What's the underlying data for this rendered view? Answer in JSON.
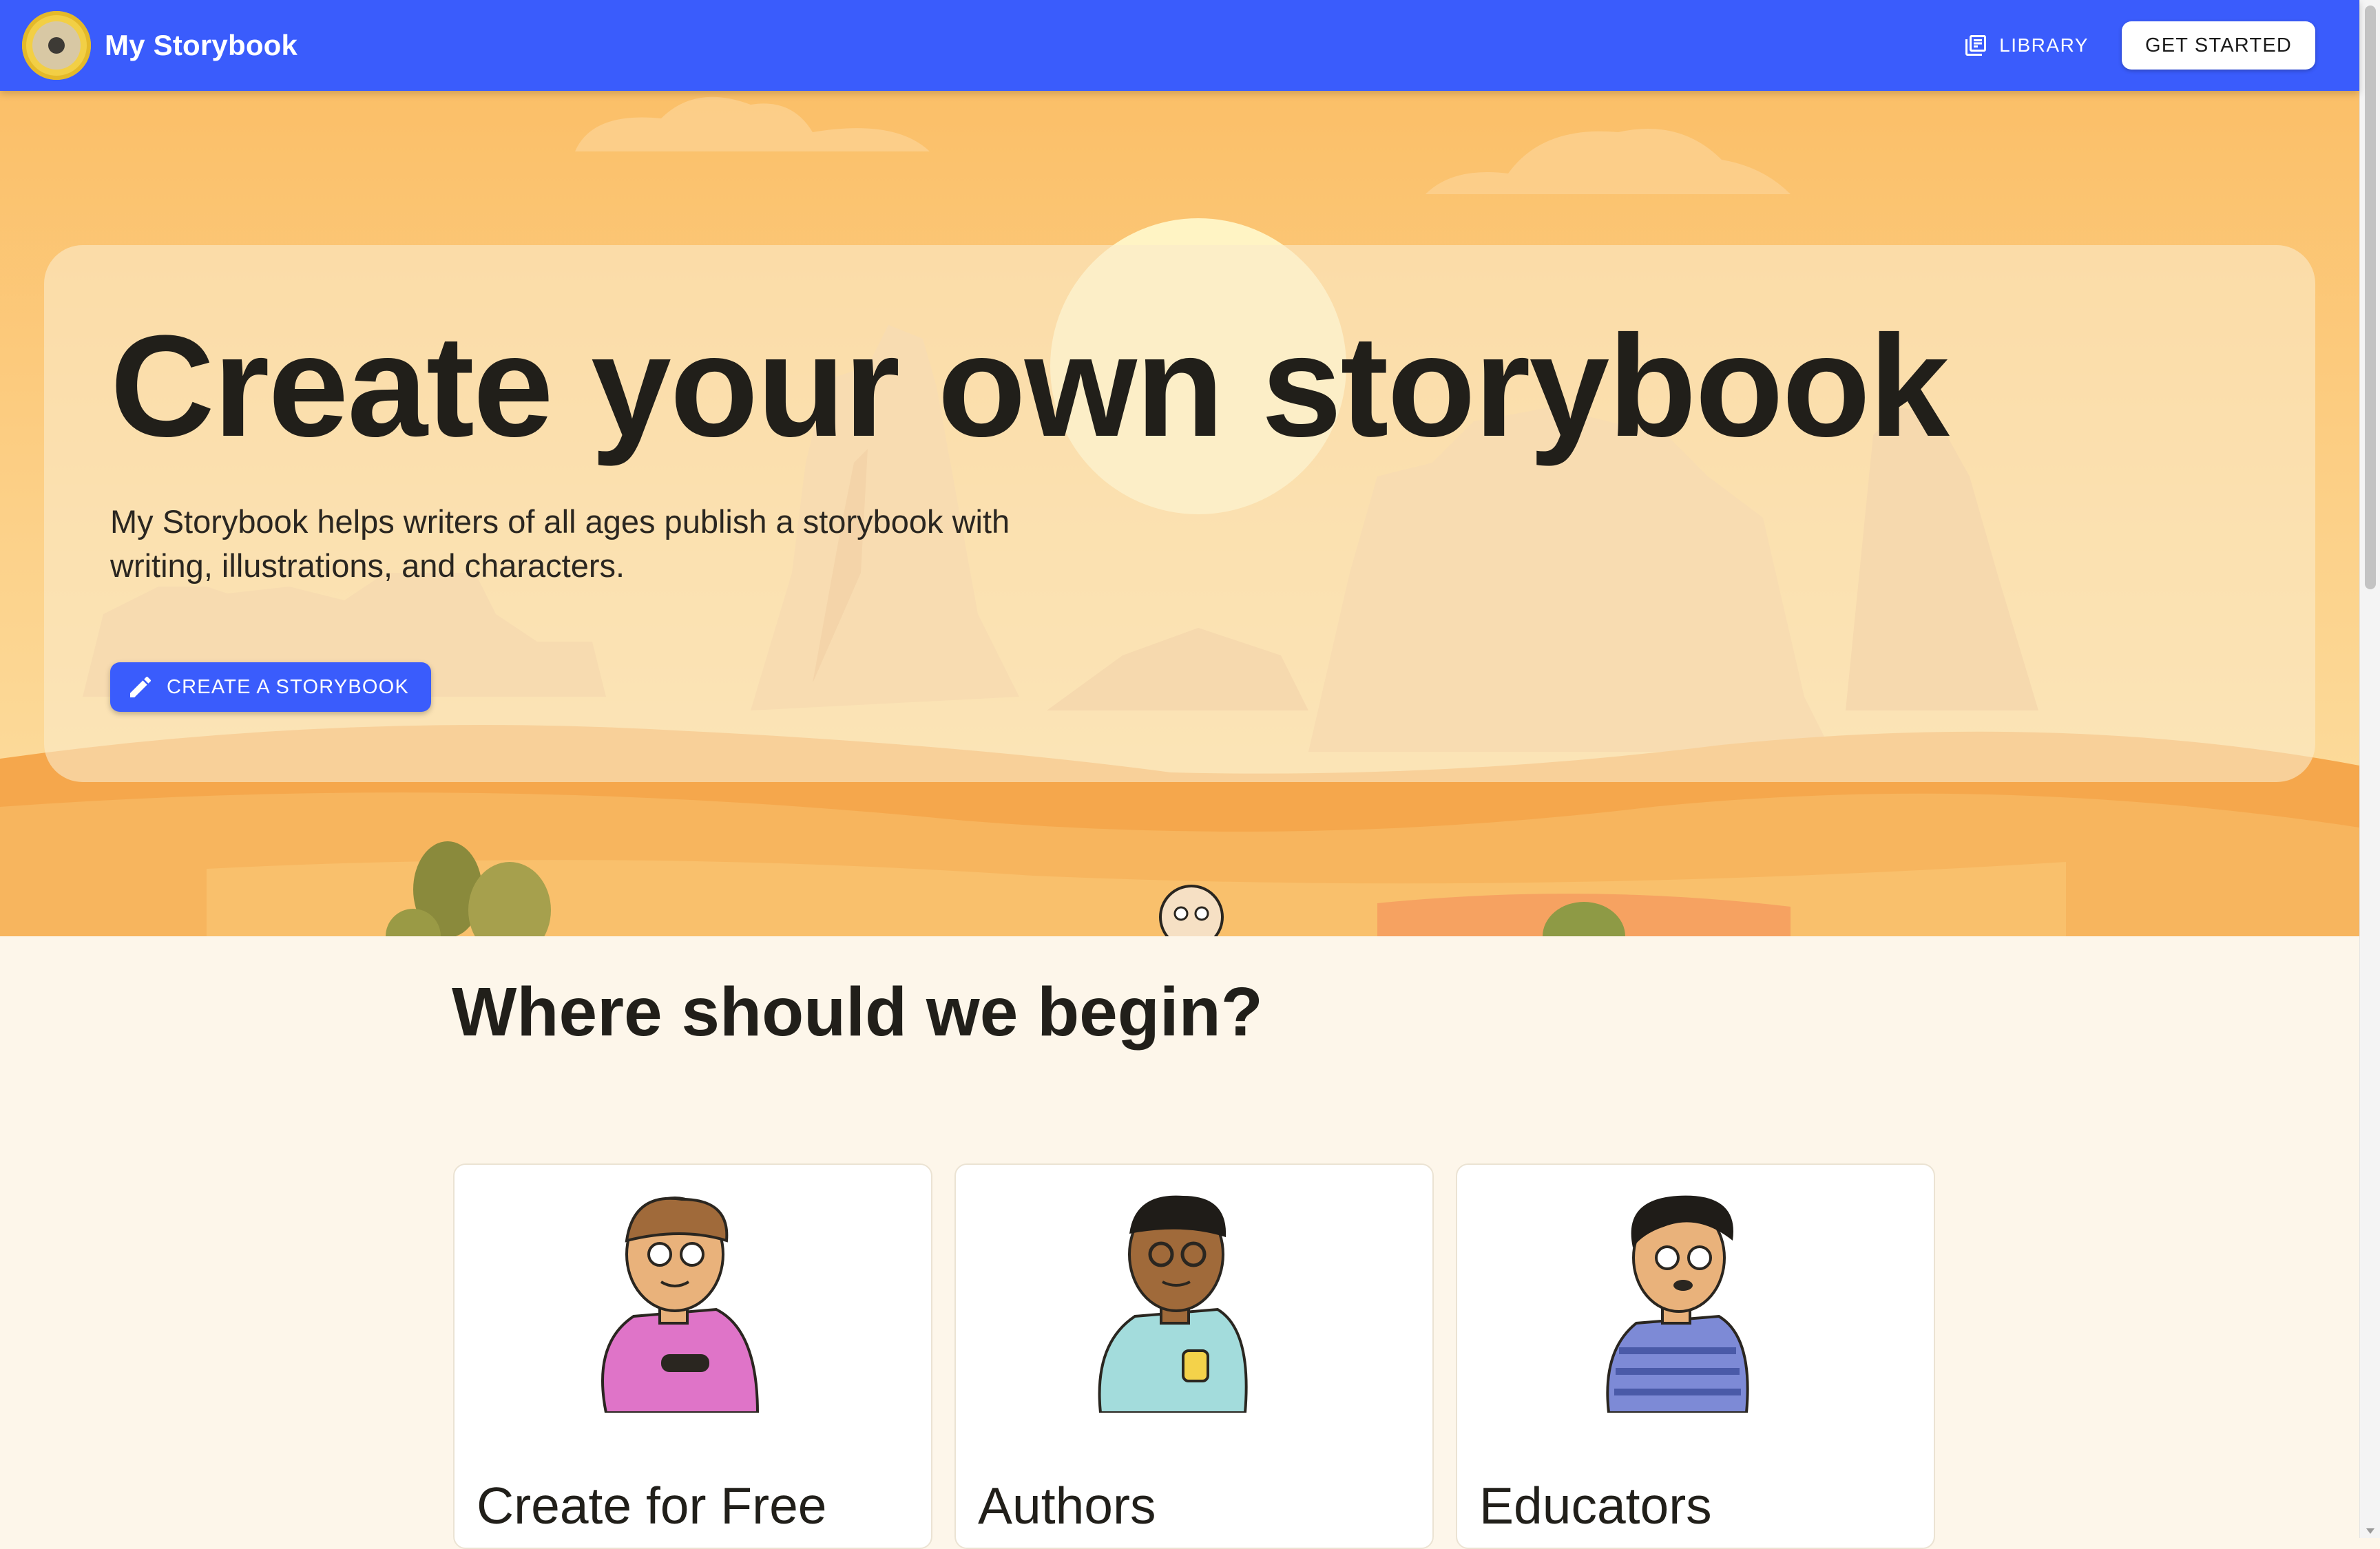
{
  "header": {
    "brand": "My Storybook",
    "nav_library": "LIBRARY",
    "get_started": "GET STARTED",
    "accent": "#3a5cfc"
  },
  "hero": {
    "title": "Create your own storybook",
    "subtitle": "My Storybook helps writers of all ages publish a storybook with writing, illustrations, and characters.",
    "create_button": "CREATE A STORYBOOK"
  },
  "section": {
    "title": "Where should we begin?",
    "cards": [
      {
        "title": "Create for Free",
        "illustration": "person-with-game-controller"
      },
      {
        "title": "Authors",
        "illustration": "person-with-mug"
      },
      {
        "title": "Educators",
        "illustration": "person-pointing"
      }
    ]
  },
  "icons": {
    "logo": "storybook-logo-icon",
    "library": "library-books-icon",
    "create": "pencil-icon"
  }
}
